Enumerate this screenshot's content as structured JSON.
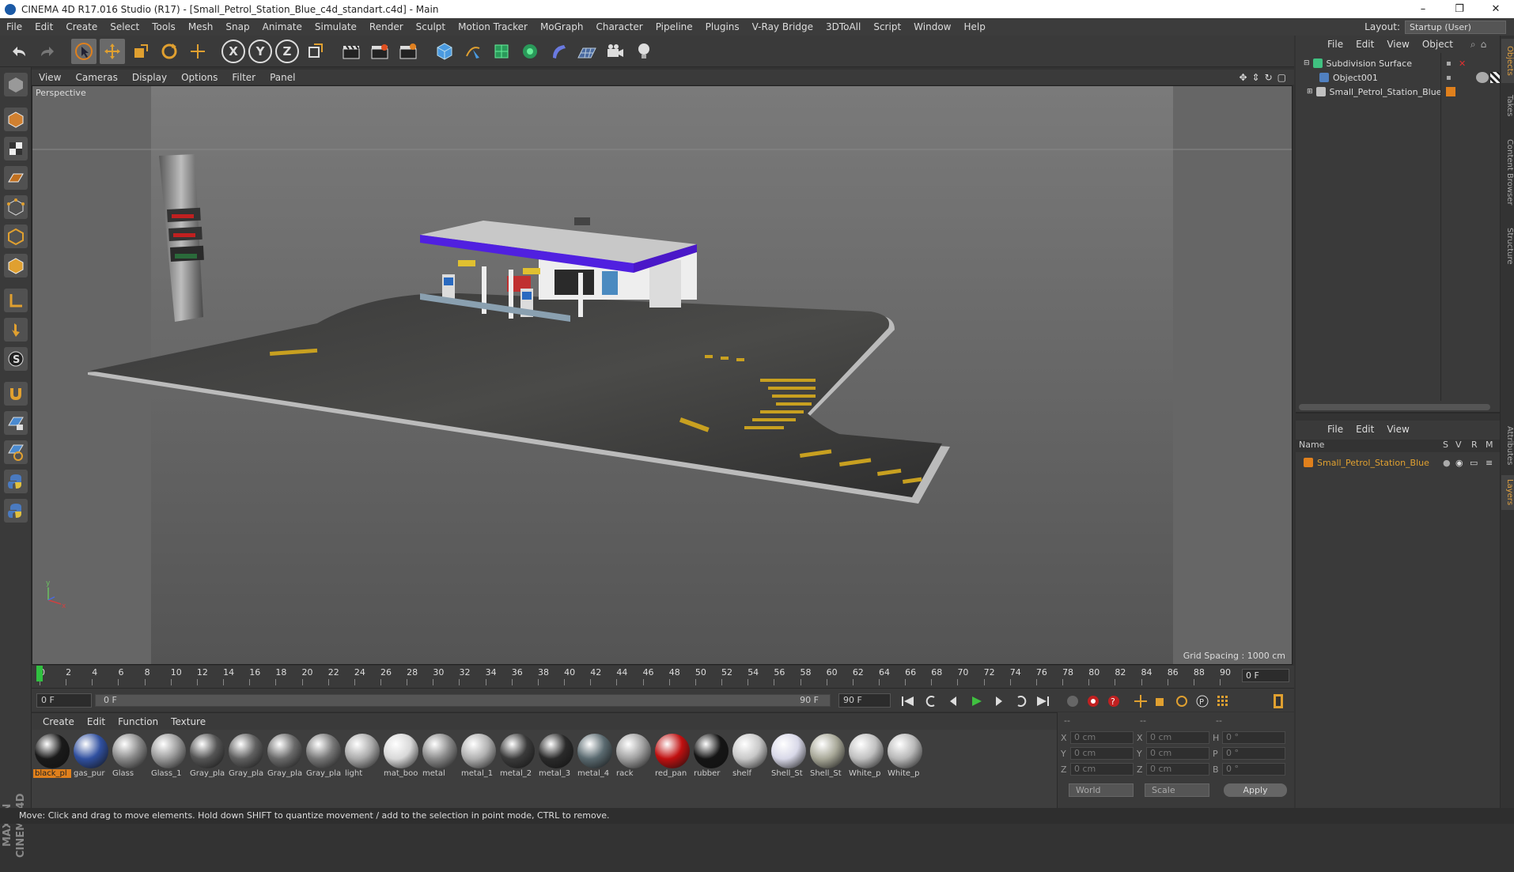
{
  "window": {
    "title": "CINEMA 4D R17.016 Studio (R17) - [Small_Petrol_Station_Blue_c4d_standart.c4d] - Main",
    "min": "–",
    "restore": "❐",
    "close": "✕"
  },
  "menu": [
    "File",
    "Edit",
    "Create",
    "Select",
    "Tools",
    "Mesh",
    "Snap",
    "Animate",
    "Simulate",
    "Render",
    "Sculpt",
    "Motion Tracker",
    "MoGraph",
    "Character",
    "Pipeline",
    "Plugins",
    "V-Ray Bridge",
    "3DToAll",
    "Script",
    "Window",
    "Help"
  ],
  "layout": {
    "label": "Layout:",
    "value": "Startup (User)"
  },
  "toolbar": {
    "x": "X",
    "y": "Y",
    "z": "Z"
  },
  "viewport": {
    "menu": [
      "View",
      "Cameras",
      "Display",
      "Options",
      "Filter",
      "Panel"
    ],
    "camera": "Perspective",
    "grid_spacing": "Grid Spacing : 1000 cm"
  },
  "timeline": {
    "ticks": [
      "0",
      "2",
      "4",
      "6",
      "8",
      "10",
      "12",
      "14",
      "16",
      "18",
      "20",
      "22",
      "24",
      "26",
      "28",
      "30",
      "32",
      "34",
      "36",
      "38",
      "40",
      "42",
      "44",
      "46",
      "48",
      "50",
      "52",
      "54",
      "56",
      "58",
      "60",
      "62",
      "64",
      "66",
      "68",
      "70",
      "72",
      "74",
      "76",
      "78",
      "80",
      "82",
      "84",
      "86",
      "88",
      "90"
    ],
    "current_frame": "0 F",
    "start": "0 F",
    "slider_start": "0 F",
    "slider_end": "90 F",
    "end": "90 F"
  },
  "materials": {
    "menu": [
      "Create",
      "Edit",
      "Function",
      "Texture"
    ],
    "items": [
      {
        "name": "black_pl",
        "color": "#1a1a1a"
      },
      {
        "name": "gas_pur",
        "color": "#3050a0"
      },
      {
        "name": "Glass",
        "color": "#8a8a8a"
      },
      {
        "name": "Glass_1",
        "color": "#9a9a9a"
      },
      {
        "name": "Gray_pla",
        "color": "#555555"
      },
      {
        "name": "Gray_pla",
        "color": "#606060"
      },
      {
        "name": "Gray_pla",
        "color": "#6a6a6a"
      },
      {
        "name": "Gray_pla",
        "color": "#777777"
      },
      {
        "name": "light",
        "color": "#aaaaaa"
      },
      {
        "name": "mat_boo",
        "color": "#d8d8d8"
      },
      {
        "name": "metal",
        "color": "#8a8a8a"
      },
      {
        "name": "metal_1",
        "color": "#b0b0b0"
      },
      {
        "name": "metal_2",
        "color": "#3a3a3a"
      },
      {
        "name": "metal_3",
        "color": "#2a2a2a"
      },
      {
        "name": "metal_4",
        "color": "#5a6a70"
      },
      {
        "name": "rack",
        "color": "#a0a0a0"
      },
      {
        "name": "red_pan",
        "color": "#c01010"
      },
      {
        "name": "rubber",
        "color": "#151515"
      },
      {
        "name": "shelf",
        "color": "#c8c8c8"
      },
      {
        "name": "Shell_St",
        "color": "#d8d8e8"
      },
      {
        "name": "Shell_St",
        "color": "#a8a898"
      },
      {
        "name": "White_p",
        "color": "#c0c0c0"
      },
      {
        "name": "White_p",
        "color": "#b8b8b8"
      }
    ]
  },
  "coordinates": {
    "header": [
      "--",
      "--",
      "--"
    ],
    "rows": [
      {
        "a": "X",
        "av": "0 cm",
        "b": "X",
        "bv": "0 cm",
        "c": "H",
        "cv": "0 °"
      },
      {
        "a": "Y",
        "av": "0 cm",
        "b": "Y",
        "bv": "0 cm",
        "c": "P",
        "cv": "0 °"
      },
      {
        "a": "Z",
        "av": "0 cm",
        "b": "Z",
        "bv": "0 cm",
        "c": "B",
        "cv": "0 °"
      }
    ],
    "mode": "World",
    "scale": "Scale",
    "apply": "Apply"
  },
  "objects": {
    "menu": [
      "File",
      "Edit",
      "View",
      "Object"
    ],
    "items": [
      {
        "name": "Subdivision Surface",
        "icon_color": "#40c080"
      },
      {
        "name": "Object001",
        "icon_color": "#5080c0"
      },
      {
        "name": "Small_Petrol_Station_Blue",
        "icon_color": "#c0c0c0"
      }
    ]
  },
  "layers": {
    "menu": [
      "File",
      "Edit",
      "View"
    ],
    "columns": [
      "Name",
      "S",
      "V",
      "R",
      "M"
    ],
    "items": [
      {
        "name": "Small_Petrol_Station_Blue",
        "color": "#e0801c"
      }
    ]
  },
  "side_tabs": [
    "Objects",
    "Takes",
    "Content Browser",
    "Structure",
    "Attributes",
    "Layers"
  ],
  "status": "Move: Click and drag to move elements. Hold down SHIFT to quantize movement / add to the selection in point mode, CTRL to remove."
}
